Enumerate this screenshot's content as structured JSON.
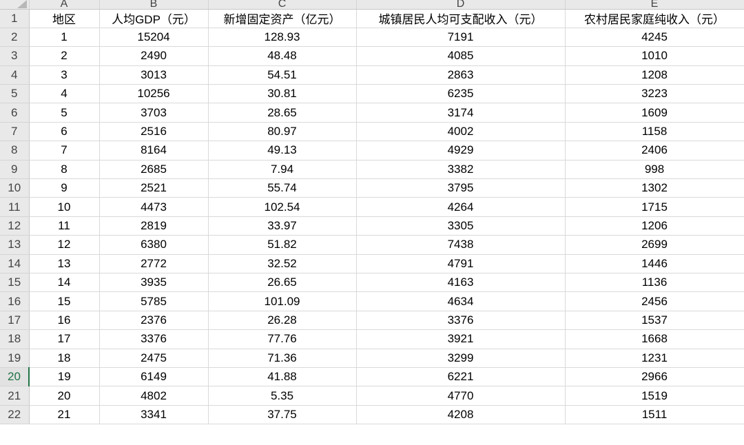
{
  "spreadsheet": {
    "column_headers": [
      "A",
      "B",
      "C",
      "D",
      "E"
    ],
    "active_row": "20",
    "header_row": {
      "row_number": "1",
      "cells": [
        "地区",
        "人均GDP（元）",
        "新增固定资产（亿元）",
        "城镇居民人均可支配收入（元）",
        "农村居民家庭纯收入（元）"
      ]
    },
    "rows": [
      {
        "row_number": "2",
        "cells": [
          "1",
          "15204",
          "128.93",
          "7191",
          "4245"
        ]
      },
      {
        "row_number": "3",
        "cells": [
          "2",
          "2490",
          "48.48",
          "4085",
          "1010"
        ]
      },
      {
        "row_number": "4",
        "cells": [
          "3",
          "3013",
          "54.51",
          "2863",
          "1208"
        ]
      },
      {
        "row_number": "5",
        "cells": [
          "4",
          "10256",
          "30.81",
          "6235",
          "3223"
        ]
      },
      {
        "row_number": "6",
        "cells": [
          "5",
          "3703",
          "28.65",
          "3174",
          "1609"
        ]
      },
      {
        "row_number": "7",
        "cells": [
          "6",
          "2516",
          "80.97",
          "4002",
          "1158"
        ]
      },
      {
        "row_number": "8",
        "cells": [
          "7",
          "8164",
          "49.13",
          "4929",
          "2406"
        ]
      },
      {
        "row_number": "9",
        "cells": [
          "8",
          "2685",
          "7.94",
          "3382",
          "998"
        ]
      },
      {
        "row_number": "10",
        "cells": [
          "9",
          "2521",
          "55.74",
          "3795",
          "1302"
        ]
      },
      {
        "row_number": "11",
        "cells": [
          "10",
          "4473",
          "102.54",
          "4264",
          "1715"
        ]
      },
      {
        "row_number": "12",
        "cells": [
          "11",
          "2819",
          "33.97",
          "3305",
          "1206"
        ]
      },
      {
        "row_number": "13",
        "cells": [
          "12",
          "6380",
          "51.82",
          "7438",
          "2699"
        ]
      },
      {
        "row_number": "14",
        "cells": [
          "13",
          "2772",
          "32.52",
          "4791",
          "1446"
        ]
      },
      {
        "row_number": "15",
        "cells": [
          "14",
          "3935",
          "26.65",
          "4163",
          "1136"
        ]
      },
      {
        "row_number": "16",
        "cells": [
          "15",
          "5785",
          "101.09",
          "4634",
          "2456"
        ]
      },
      {
        "row_number": "17",
        "cells": [
          "16",
          "2376",
          "26.28",
          "3376",
          "1537"
        ]
      },
      {
        "row_number": "18",
        "cells": [
          "17",
          "3376",
          "77.76",
          "3921",
          "1668"
        ]
      },
      {
        "row_number": "19",
        "cells": [
          "18",
          "2475",
          "71.36",
          "3299",
          "1231"
        ]
      },
      {
        "row_number": "20",
        "cells": [
          "19",
          "6149",
          "41.88",
          "6221",
          "2966"
        ]
      },
      {
        "row_number": "21",
        "cells": [
          "20",
          "4802",
          "5.35",
          "4770",
          "1519"
        ]
      },
      {
        "row_number": "22",
        "cells": [
          "21",
          "3341",
          "37.75",
          "4208",
          "1511"
        ]
      }
    ]
  }
}
